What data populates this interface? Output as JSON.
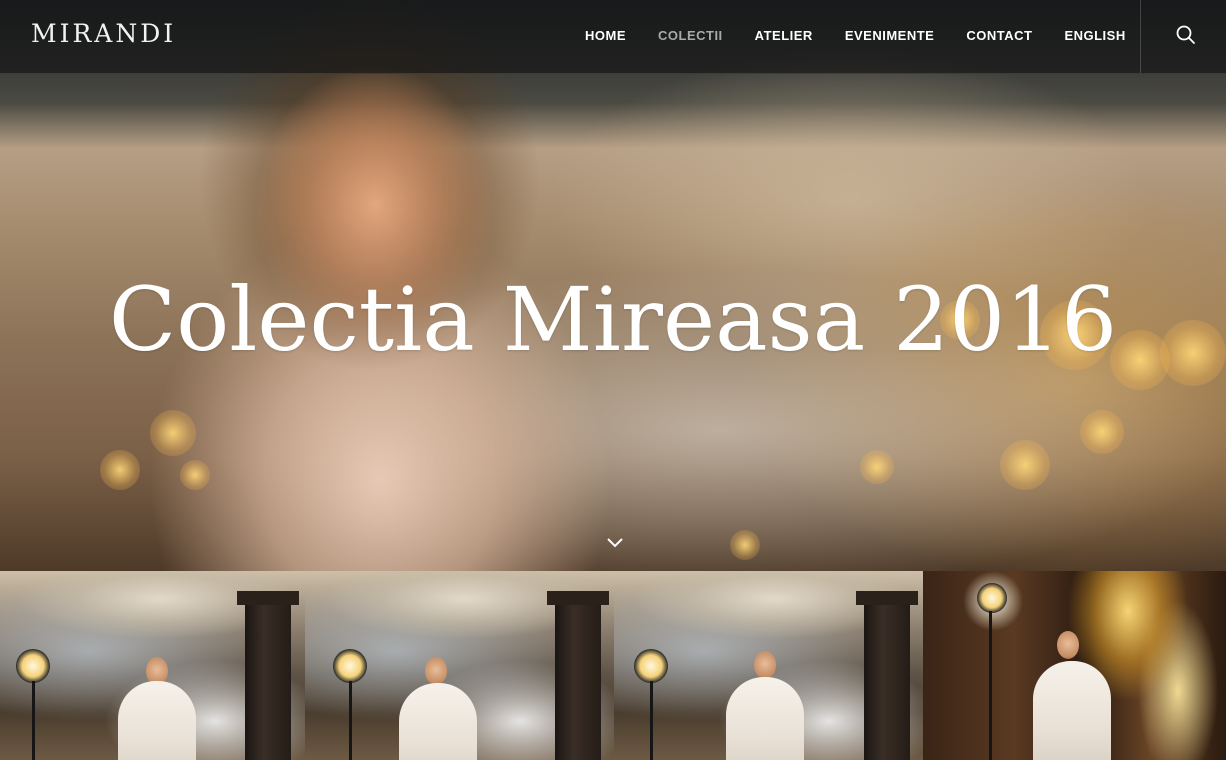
{
  "brand": {
    "logo_text": "MIRANDI"
  },
  "nav": {
    "items": [
      {
        "label": "HOME",
        "active": false
      },
      {
        "label": "COLECTII",
        "active": true
      },
      {
        "label": "ATELIER",
        "active": false
      },
      {
        "label": "EVENIMENTE",
        "active": false
      },
      {
        "label": "CONTACT",
        "active": false
      },
      {
        "label": "ENGLISH",
        "active": false
      }
    ]
  },
  "icons": {
    "search": "search-icon",
    "scroll": "chevron-down-icon"
  },
  "hero": {
    "title": "Colectia Mireasa 2016"
  },
  "gallery": {
    "count": 4
  },
  "colors": {
    "header_bg": "#161616",
    "nav_text": "#ffffff",
    "nav_muted": "#a9a9a9",
    "hero_title": "#ffffff"
  }
}
